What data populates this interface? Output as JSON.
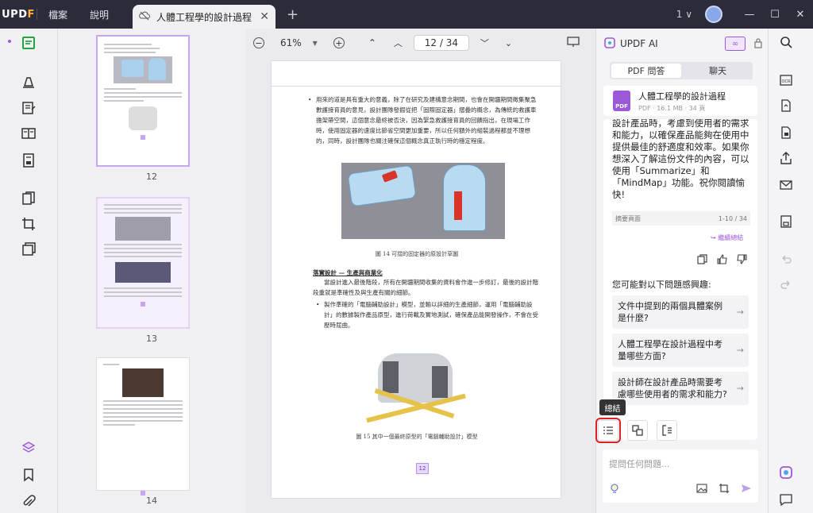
{
  "app": {
    "logo": "UPDF"
  },
  "menu": {
    "file": "檔案",
    "help": "說明"
  },
  "tab": {
    "title": "人體工程學的設計過程"
  },
  "titlebar": {
    "window_count": "1"
  },
  "doc_toolbar": {
    "zoom": "61%",
    "page_current": "12",
    "page_sep": "/",
    "page_total": "34"
  },
  "thumbnails": [
    {
      "label": "12"
    },
    {
      "label": "13"
    },
    {
      "label": "14"
    }
  ],
  "document": {
    "bullet1": "用來的道是具有重大的意義，除了在研究及建構意念期間，也會在開疆期間徵集聚急數護接育員的意見，設計團隊發掘從把「固際固定器」摺疊的概念，為傳統的救護車擔架帶空間，這個意念最終被否決，因為緊急救護接育員的回饋指出，在現場工作時，使用固定器的速度比節省空間更加重要，所以任何額外的組裝過程都並不理想的，同時，設計團隊也關注確保這個概念真正執行時的穩定程度。",
    "fig14": "圖 14 可摺的固定器的原設計草圖",
    "heading": "落實設計 — 生產與商業化",
    "para": "當設計進入最後階段，所有在開疆期間收集的資料會作進一步修訂，最後的設計階段重就是準確性及與生產有關的細節。",
    "bullet2": "製作準確的「電腦輔助設計」模型，並輸以詳細的生產細節，運用「電腦輔助設計」的數據製作產品原型，進行荷載及實地測試，確保產品能開發操作，不會在受壓時屈曲。",
    "fig15": "圖 15 其中一個最終原型的「電腦輔助設計」模型",
    "page_badge": "12"
  },
  "ai": {
    "title": "UPDF AI",
    "tab_pdf": "PDF 問答",
    "tab_chat": "聊天",
    "file_name": "人體工程學的設計過程",
    "file_meta": "PDF · 16.1 MB · 34 頁",
    "answer": "設計產品時，考慮到使用者的需求和能力，以確保產品能夠在使用中提供最佳的舒適度和效率。如果你想深入了解這份文件的內容，可以使用「Summarize」和「MindMap」功能。祝你閱讀愉快!",
    "pages_label": "摘要頁面",
    "pages_range": "1-10 / 34",
    "continue": "繼續總結",
    "interest": "您可能對以下問題感興趣:",
    "suggestions": [
      "文件中提到的兩個具體案例是什麼?",
      "人體工程學在設計過程中考量哪些方面?",
      "設計師在設計產品時需要考慮哪些使用者的需求和能力?"
    ],
    "tooltip": "總結",
    "input_placeholder": "提問任何問題..."
  },
  "colors": {
    "accent": "#9b59d8",
    "titlebar": "#2b2b3a",
    "highlight": "#e02020"
  }
}
